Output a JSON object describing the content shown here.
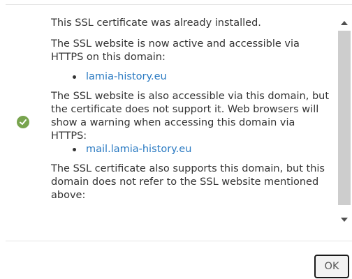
{
  "message": {
    "already_installed": "This SSL certificate was already installed.",
    "active_intro": "The SSL website is now active and accessible via HTTPS on this domain:",
    "active_domains": [
      "lamia-history.eu"
    ],
    "warning_intro": "The SSL website is also accessible via this domain, but the certificate does not support it. Web browsers will show a warning when accessing this domain via HTTPS:",
    "warning_domains": [
      "mail.lamia-history.eu"
    ],
    "unreferenced_intro": "The SSL certificate also supports this domain, but this domain does not refer to the SSL website mentioned above:"
  },
  "status_icon": "check-circle-icon",
  "colors": {
    "success": "#78a44e",
    "link": "#2a7ac2"
  },
  "footer": {
    "ok_label": "OK"
  }
}
